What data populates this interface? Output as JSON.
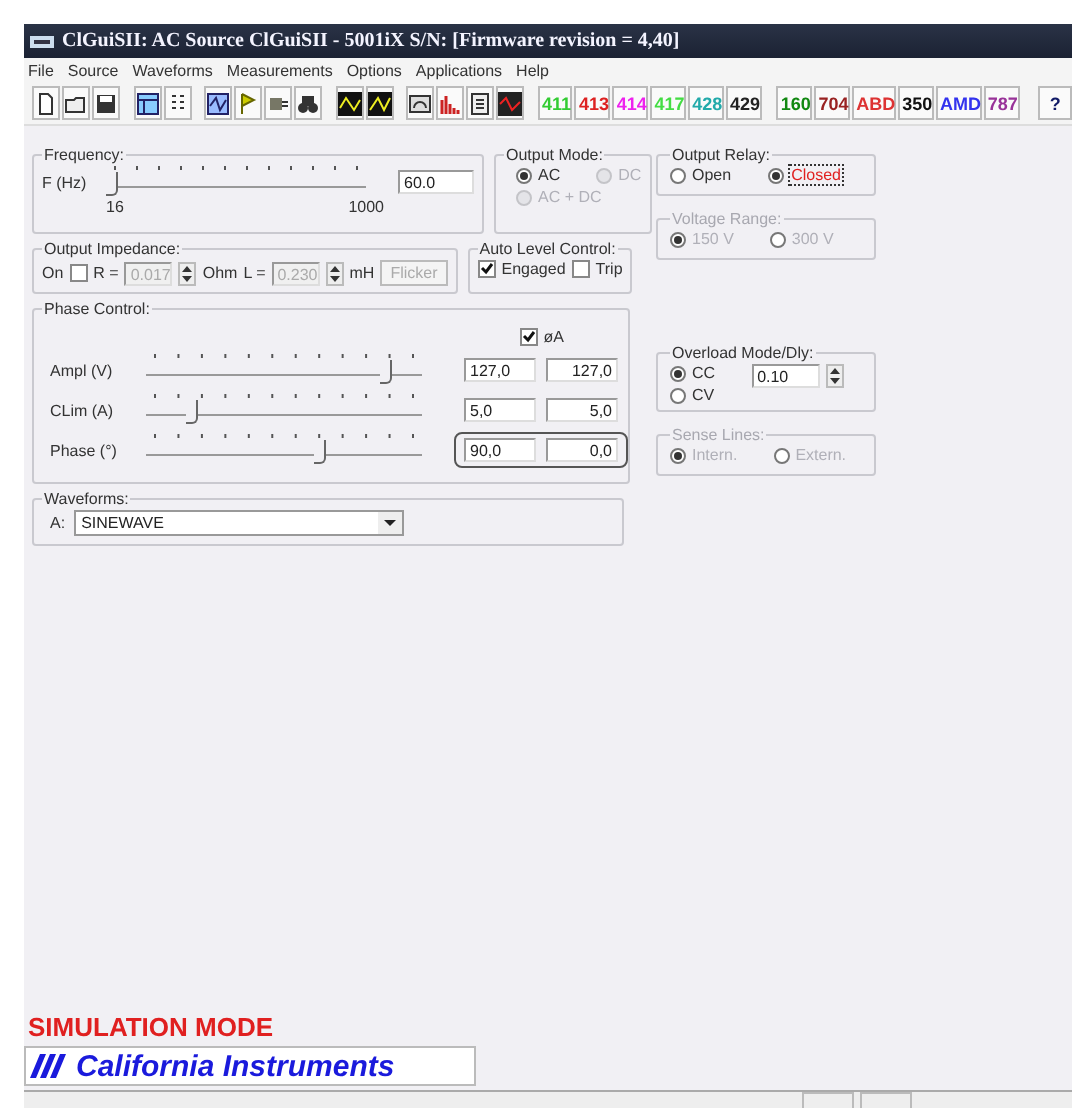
{
  "window": {
    "title": "ClGuiSII: AC Source ClGuiSII - 5001iX S/N:  [Firmware revision = 4,40]"
  },
  "menu": [
    "File",
    "Source",
    "Waveforms",
    "Measurements",
    "Options",
    "Applications",
    "Help"
  ],
  "toolbar_labels": [
    {
      "label": "411",
      "color": "#33cc33"
    },
    {
      "label": "413",
      "color": "#dd2222"
    },
    {
      "label": "414",
      "color": "#ee22ee"
    },
    {
      "label": "417",
      "color": "#44dd44"
    },
    {
      "label": "428",
      "color": "#22aaaa"
    },
    {
      "label": "429",
      "color": "#222222"
    },
    {
      "label": "160",
      "color": "#118811"
    },
    {
      "label": "704",
      "color": "#992222"
    },
    {
      "label": "ABD",
      "color": "#dd3333"
    },
    {
      "label": "350",
      "color": "#111111"
    },
    {
      "label": "AMD",
      "color": "#3333ee"
    },
    {
      "label": "787",
      "color": "#993399"
    }
  ],
  "help": "?",
  "frequency": {
    "title": "Frequency:",
    "label": "F (Hz)",
    "level": 0.02,
    "min": "16",
    "max": "1000",
    "value": "60.0"
  },
  "output_mode": {
    "title": "Output Mode:",
    "disabled": false,
    "options": [
      {
        "label": "AC",
        "selected": true,
        "disabled": false
      },
      {
        "label": "DC",
        "selected": false,
        "disabled": true
      },
      {
        "label": "AC + DC",
        "selected": false,
        "disabled": true
      }
    ]
  },
  "output_impedance": {
    "title": "Output Impedance:",
    "on_label": "On",
    "on_checked": false,
    "r_label": "R =",
    "r_value": "0.017",
    "ohm": "Ohm",
    "l_label": "L =",
    "l_value": "0.230",
    "mh": "mH",
    "flicker": "Flicker"
  },
  "auto_level": {
    "title": "Auto Level Control:",
    "checks": [
      {
        "label": "Engaged",
        "checked": true
      },
      {
        "label": "Trip",
        "checked": false
      }
    ]
  },
  "phase_control": {
    "title": "Phase Control:",
    "phase_a": {
      "label": "øA",
      "checked": true
    },
    "rows": [
      {
        "label": "Ampl (V)",
        "level": 0.87,
        "set": "127,0",
        "actual": "127,0",
        "highlighted": false
      },
      {
        "label": "CLim (A)",
        "level": 0.17,
        "set": "5,0",
        "actual": "5,0",
        "highlighted": false
      },
      {
        "label": "Phase (°)",
        "level": 0.63,
        "set": "90,0",
        "actual": "0,0",
        "highlighted": true
      }
    ]
  },
  "waveforms": {
    "title": "Waveforms:",
    "label": "A:",
    "value": "SINEWAVE"
  },
  "output_relay": {
    "title": "Output Relay:",
    "disabled": false,
    "options": [
      {
        "label": "Open",
        "selected": false,
        "disabled": false
      },
      {
        "label": "Closed",
        "selected": true,
        "disabled": false
      }
    ]
  },
  "voltage_range": {
    "title": "Voltage Range:",
    "disabled": true,
    "options": [
      {
        "label": "150 V",
        "selected": true
      },
      {
        "label": "300 V",
        "selected": false
      }
    ]
  },
  "overload": {
    "title": "Overload Mode/Dly:",
    "disabled": false,
    "options": [
      {
        "label": "CC",
        "selected": true,
        "disabled": false
      },
      {
        "label": "CV",
        "selected": false,
        "disabled": false
      }
    ],
    "value": "0.10"
  },
  "sense_lines": {
    "title": "Sense Lines:",
    "disabled": true,
    "options": [
      {
        "label": "Intern.",
        "selected": true
      },
      {
        "label": "Extern.",
        "selected": false
      }
    ]
  },
  "simulation": "SIMULATION MODE",
  "logo": "California Instruments"
}
